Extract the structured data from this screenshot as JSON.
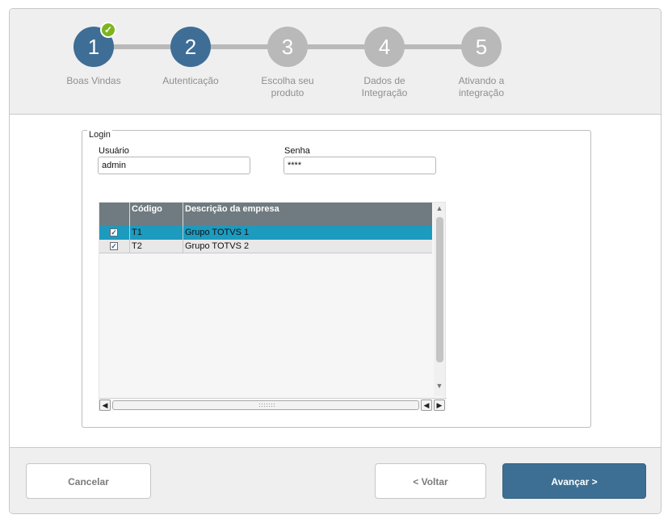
{
  "wizard": {
    "steps": [
      {
        "number": "1",
        "label": "Boas Vindas",
        "state": "done"
      },
      {
        "number": "2",
        "label": "Autenticação",
        "state": "active"
      },
      {
        "number": "3",
        "label": "Escolha seu produto",
        "state": "pending"
      },
      {
        "number": "4",
        "label": "Dados de Integração",
        "state": "pending"
      },
      {
        "number": "5",
        "label": "Ativando a integração",
        "state": "pending"
      }
    ],
    "check_glyph": "✓"
  },
  "login": {
    "legend": "Login",
    "user_label": "Usuário",
    "user_value": "admin",
    "password_label": "Senha",
    "password_value": "****"
  },
  "grid": {
    "columns": [
      "",
      "Código",
      "Descrição da empresa"
    ],
    "rows": [
      {
        "checked": true,
        "code": "T1",
        "description": "Grupo TOTVS 1",
        "selected": true
      },
      {
        "checked": true,
        "code": "T2",
        "description": "Grupo TOTVS 2",
        "selected": false
      }
    ]
  },
  "footer": {
    "cancel_label": "Cancelar",
    "back_label": "< Voltar",
    "next_label": "Avançar >"
  },
  "colors": {
    "active_step": "#3e6e96",
    "pending_step": "#b9b9b9",
    "check_badge": "#7db51e",
    "selected_row": "#1d9bbf",
    "primary_button": "#3d6f94"
  }
}
